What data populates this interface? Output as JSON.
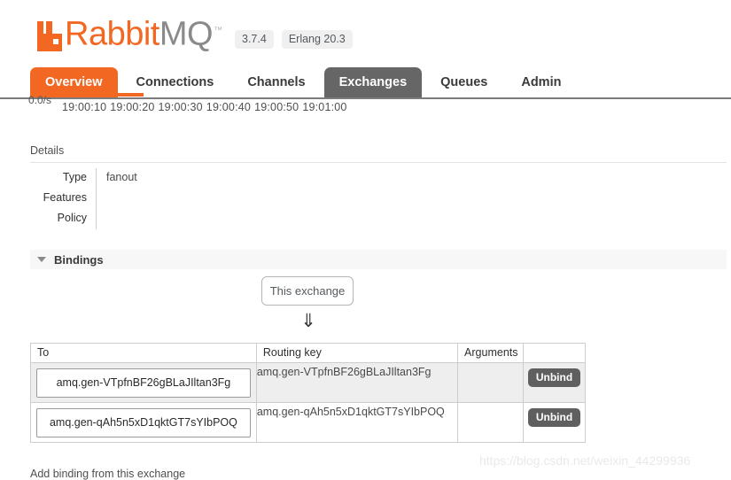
{
  "header": {
    "logo_text_part1": "Rabbit",
    "logo_text_part2": "MQ",
    "logo_tm": "™",
    "logo_icon": "rabbit-logo-icon",
    "version_badge": "3.7.4",
    "erlang_badge": "Erlang 20.3"
  },
  "nav": {
    "tabs": [
      {
        "label": "Overview",
        "state": "orange"
      },
      {
        "label": "Connections",
        "state": "normal"
      },
      {
        "label": "Channels",
        "state": "normal"
      },
      {
        "label": "Exchanges",
        "state": "active"
      },
      {
        "label": "Queues",
        "state": "normal"
      },
      {
        "label": "Admin",
        "state": "normal"
      }
    ]
  },
  "chart_remnant": {
    "ylabel": "0.0/s",
    "ticks": [
      "19:00:10",
      "19:00:20",
      "19:00:30",
      "19:00:40",
      "19:00:50",
      "19:01:00"
    ]
  },
  "details": {
    "title": "Details",
    "rows": [
      {
        "label": "Type",
        "value": "fanout"
      },
      {
        "label": "Features",
        "value": ""
      },
      {
        "label": "Policy",
        "value": ""
      }
    ]
  },
  "bindings": {
    "section_label": "Bindings",
    "caret_icon": "caret-down-icon",
    "this_exchange_label": "This exchange",
    "arrow_glyph": "⇓",
    "columns": [
      "To",
      "Routing key",
      "Arguments",
      ""
    ],
    "rows": [
      {
        "to": "amq.gen-VTpfnBF26gBLaJIltan3Fg",
        "routing_key": "amq.gen-VTpfnBF26gBLaJIltan3Fg",
        "arguments": "",
        "action_label": "Unbind"
      },
      {
        "to": "amq.gen-qAh5n5xD1qktGT7sYIbPOQ",
        "routing_key": "amq.gen-qAh5n5xD1qktGT7sYIbPOQ",
        "arguments": "",
        "action_label": "Unbind"
      }
    ],
    "add_binding_label": "Add binding from this exchange"
  },
  "watermark": {
    "text": "https://blog.csdn.net/weixin_44299936"
  },
  "colors": {
    "brand_orange": "#f26722",
    "tab_active_gray": "#666666",
    "button_gray": "#5f5f5f",
    "logo_gray": "#8a8a8a"
  }
}
